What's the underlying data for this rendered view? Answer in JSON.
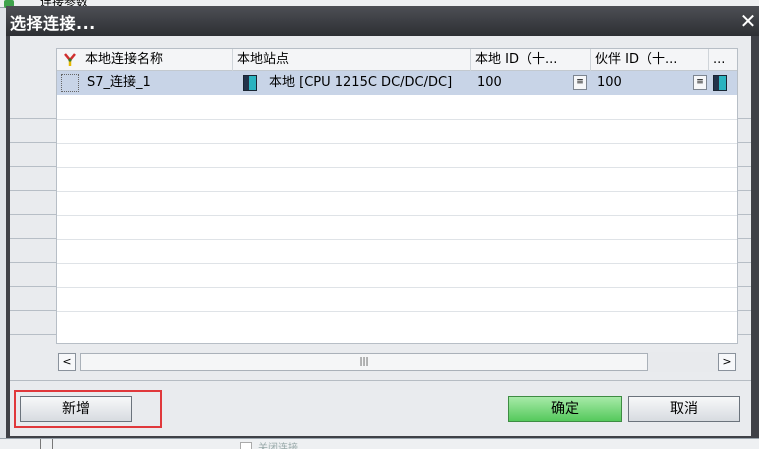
{
  "background": {
    "top_title": "连接参数",
    "bottom_text": "关闭连接"
  },
  "dialog": {
    "title": "选择连接...",
    "close_glyph": "✕"
  },
  "table": {
    "columns": [
      {
        "label": "本地连接名称",
        "icon": "connection-tree-icon"
      },
      {
        "label": "本地站点"
      },
      {
        "label": "本地 ID（十..."
      },
      {
        "label": "伙伴 ID（十..."
      },
      {
        "label": "..."
      }
    ],
    "rows": [
      {
        "name": "S7_连接_1",
        "station": "本地 [CPU 1215C DC/DC/DC]",
        "local_id": "100",
        "partner_id": "100"
      }
    ]
  },
  "scrollbar": {
    "left_arrow": "<",
    "right_arrow": ">",
    "thumb_grip": "|||"
  },
  "buttons": {
    "add": "新增",
    "ok": "确定",
    "cancel": "取消"
  },
  "colors": {
    "selected_row": "#c8d4e7",
    "ok_button": "#55c95c",
    "highlight": "#e0383b"
  }
}
